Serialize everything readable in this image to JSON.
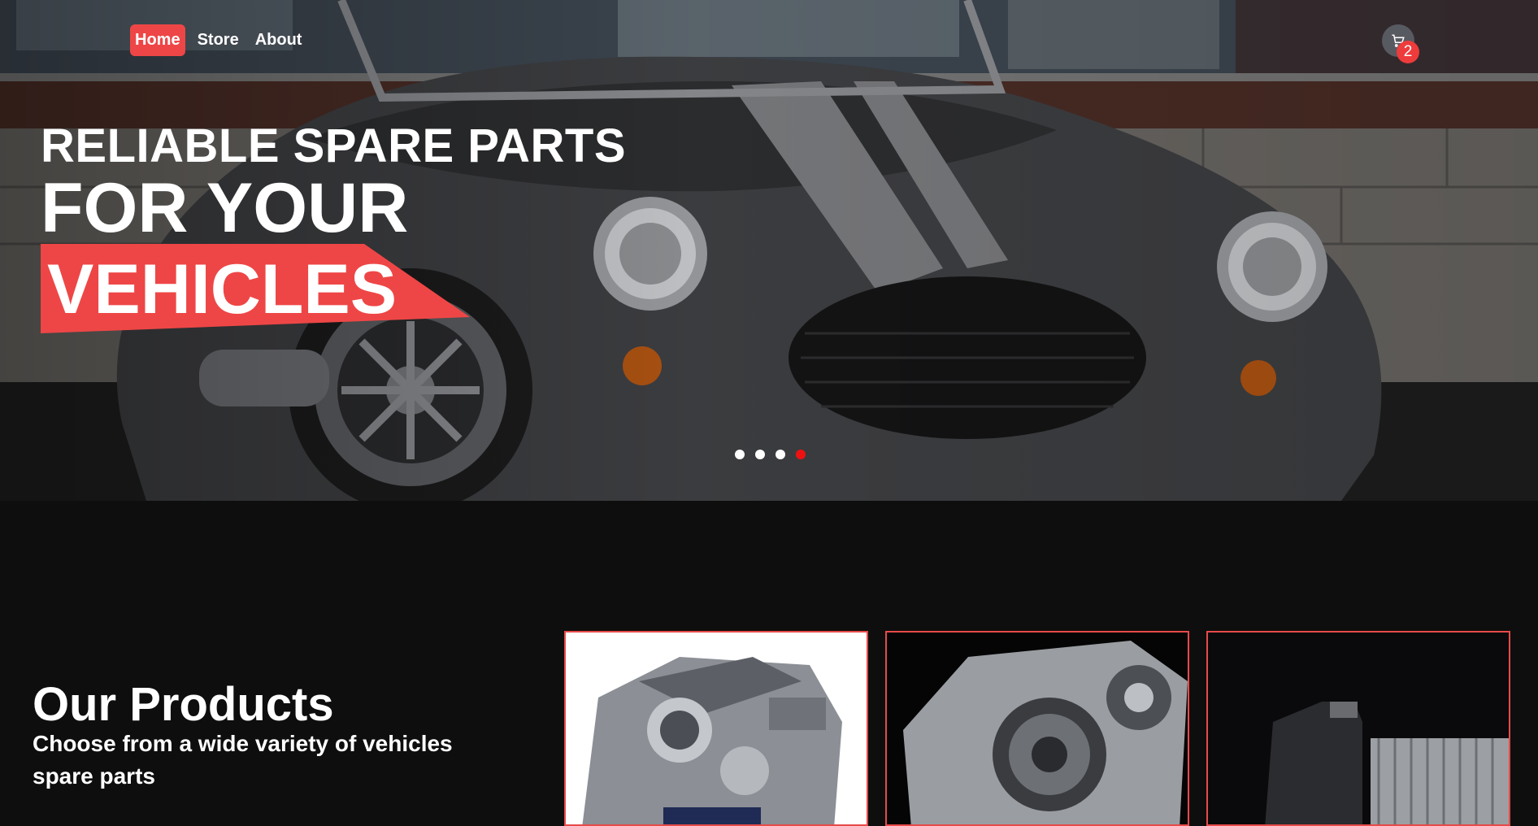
{
  "nav": {
    "items": [
      {
        "label": "Home",
        "active": true
      },
      {
        "label": "Store",
        "active": false
      },
      {
        "label": "About",
        "active": false
      }
    ]
  },
  "cart": {
    "icon": "cart-icon",
    "count": "2"
  },
  "hero": {
    "line1": "RELIABLE SPARE PARTS",
    "line2": "FOR YOUR",
    "line3": "VEHICLES",
    "accent": "#ee4646",
    "slides": 4,
    "active_slide": 4
  },
  "products": {
    "title": "Our Products",
    "subtitle": "Choose from a wide variety of vehicles spare parts",
    "cards": [
      {
        "image": "engine-image"
      },
      {
        "image": "transmission-image"
      },
      {
        "image": "oil-and-radiator-image"
      }
    ]
  }
}
